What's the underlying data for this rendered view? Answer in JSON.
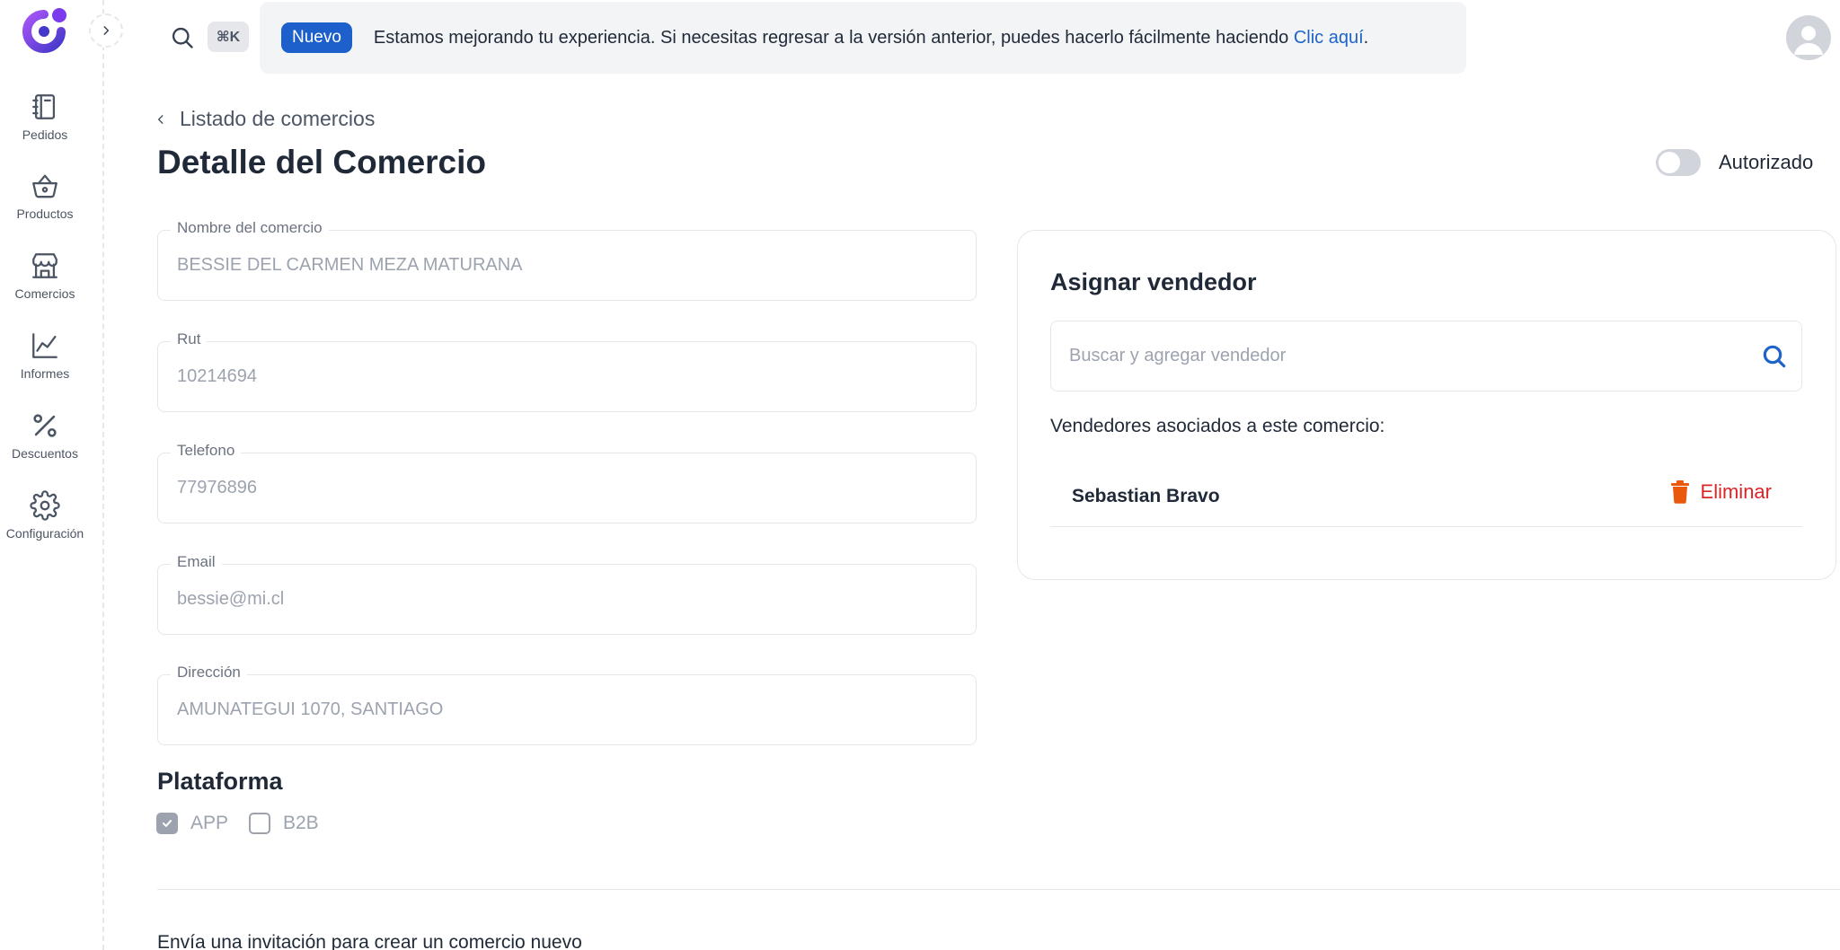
{
  "nav": {
    "items": [
      {
        "label": "Pedidos",
        "icon": "notebook-icon"
      },
      {
        "label": "Productos",
        "icon": "basket-icon"
      },
      {
        "label": "Comercios",
        "icon": "store-icon"
      },
      {
        "label": "Informes",
        "icon": "chart-line-icon"
      },
      {
        "label": "Descuentos",
        "icon": "percent-icon"
      },
      {
        "label": "Configuración",
        "icon": "gear-icon"
      }
    ]
  },
  "topbar": {
    "shortcut": "⌘K",
    "badge": "Nuevo",
    "banner_text": "Estamos mejorando tu experiencia. Si necesitas regresar a la versión anterior, puedes hacerlo fácilmente haciendo",
    "banner_link": "Clic aquí",
    "banner_end": "."
  },
  "header": {
    "breadcrumb": "Listado de comercios",
    "title": "Detalle del Comercio",
    "toggle_label": "Autorizado",
    "toggle_on": false
  },
  "form": {
    "fields": [
      {
        "label": "Nombre del comercio",
        "value": "BESSIE DEL CARMEN MEZA MATURANA"
      },
      {
        "label": "Rut",
        "value": "10214694"
      },
      {
        "label": "Telefono",
        "value": "77976896"
      },
      {
        "label": "Email",
        "value": "bessie@mi.cl"
      },
      {
        "label": "Dirección",
        "value": "AMUNATEGUI 1070, SANTIAGO"
      }
    ],
    "platform_title": "Plataforma",
    "platforms": [
      {
        "label": "APP",
        "checked": true
      },
      {
        "label": "B2B",
        "checked": false
      }
    ]
  },
  "vendor_card": {
    "title": "Asignar vendedor",
    "search_placeholder": "Buscar y agregar vendedor",
    "assoc_label": "Vendedores asociados a este comercio:",
    "vendors": [
      {
        "name": "Sebastian Bravo",
        "action": "Eliminar"
      }
    ]
  },
  "footer": {
    "invite_text": "Envía una invitación para crear un comercio nuevo"
  },
  "colors": {
    "accent": "#1d5fcb",
    "danger": "#dc2626",
    "logo_purple": "#7c3aed"
  }
}
